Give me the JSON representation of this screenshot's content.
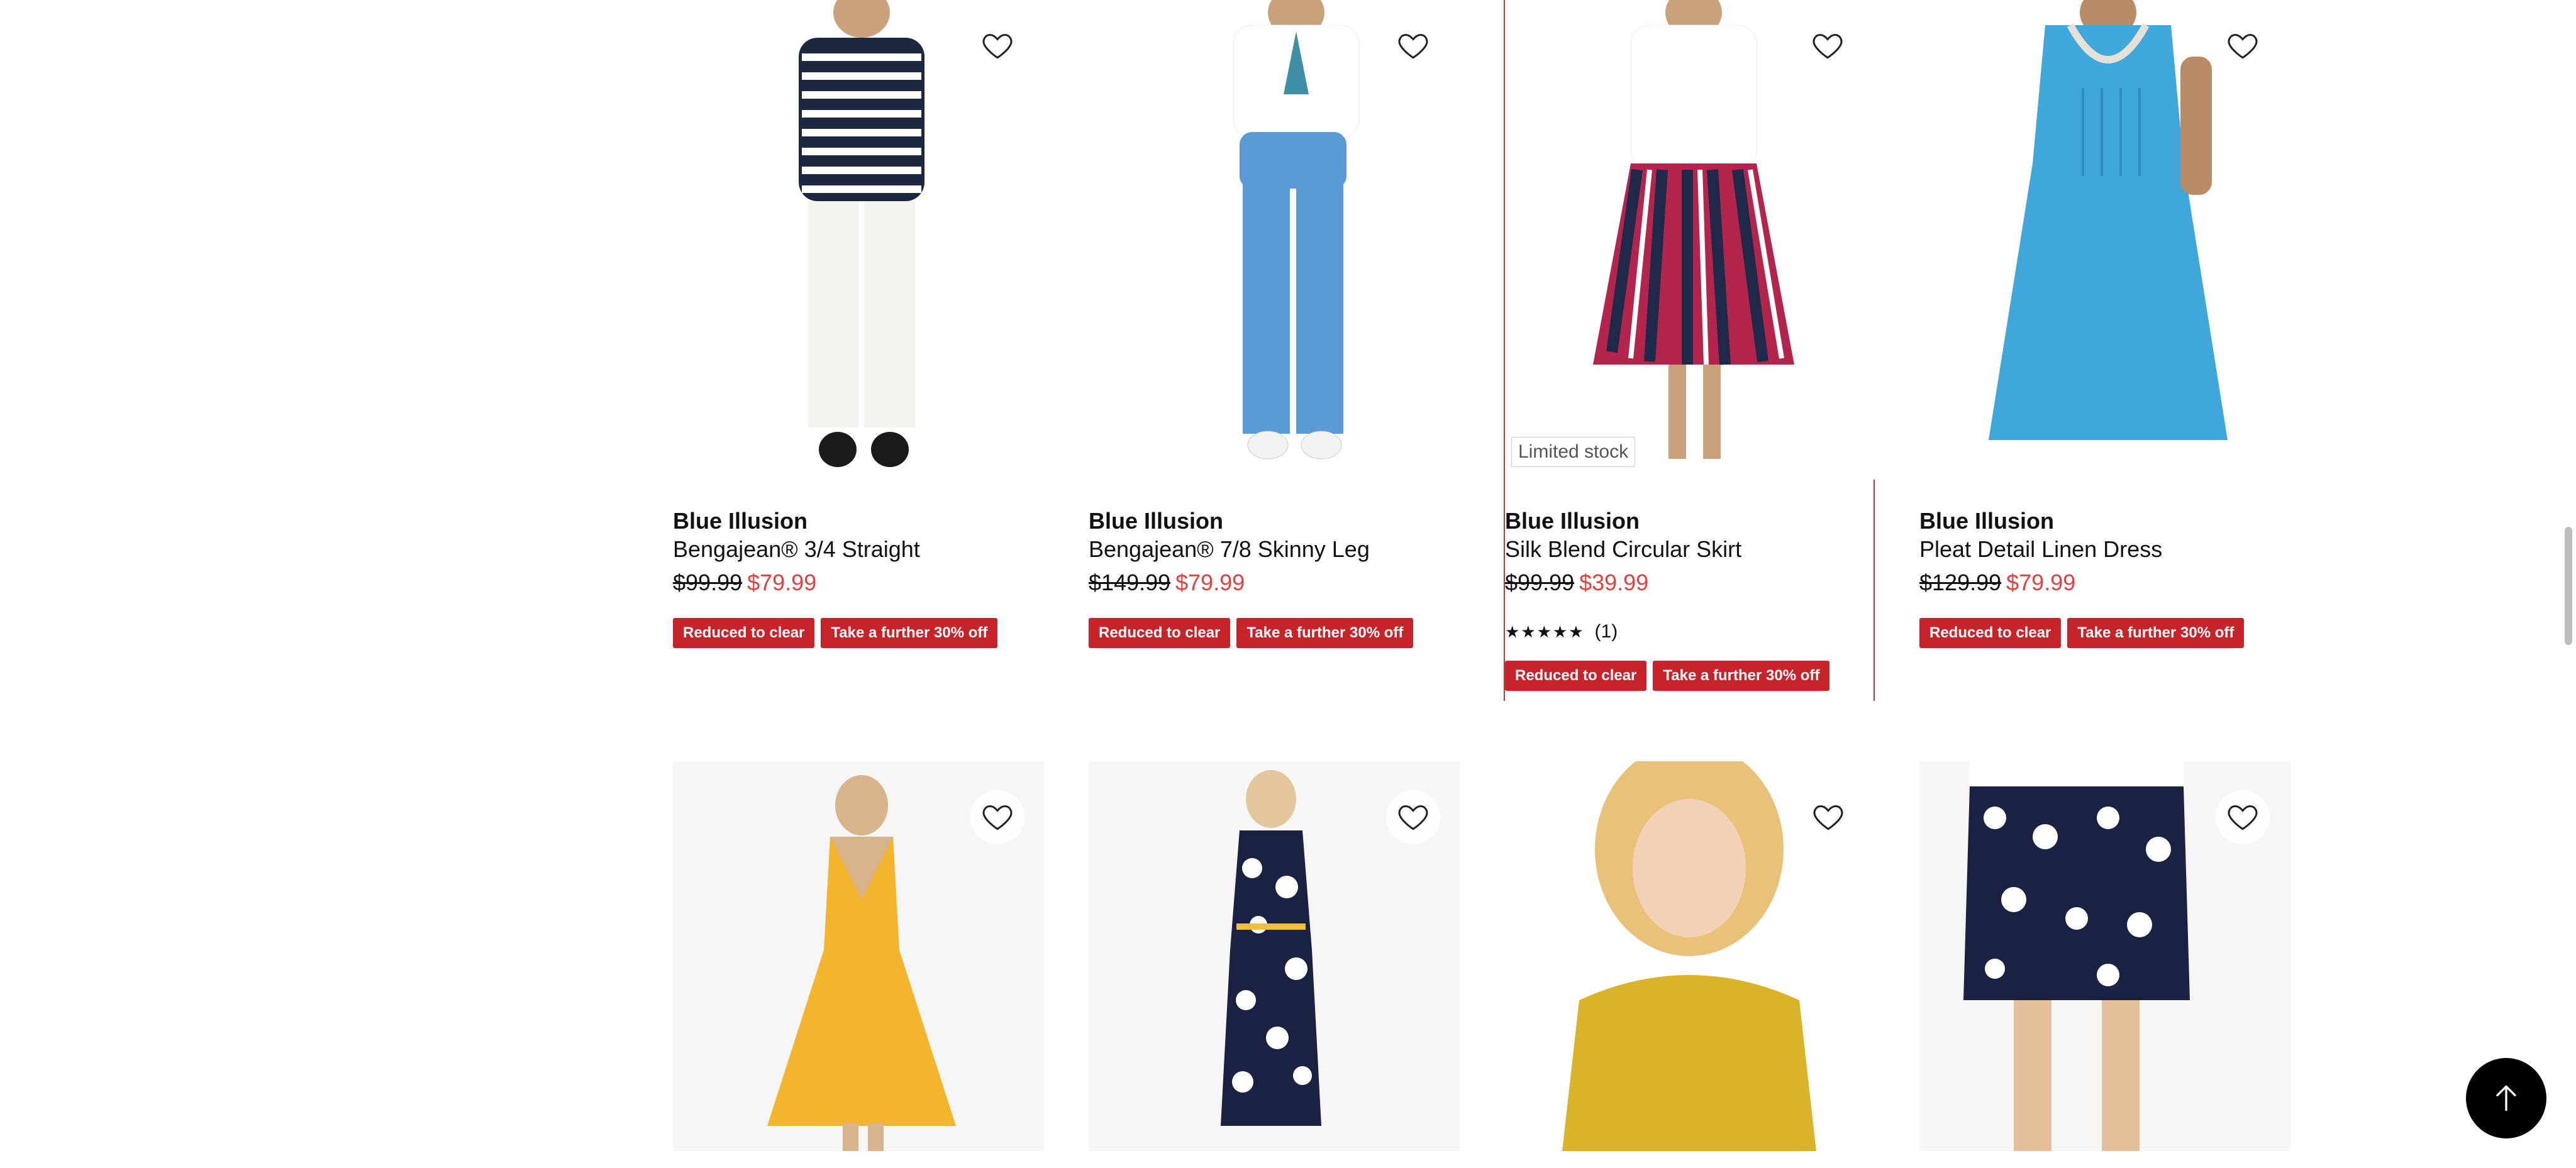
{
  "products_row1": [
    {
      "brand": "Blue Illusion",
      "name": "Bengajean® 3/4 Straight",
      "orig_price": "$99.99",
      "sale_price": "$79.99",
      "badges": [
        "Reduced to clear",
        "Take a further 30% off"
      ]
    },
    {
      "brand": "Blue Illusion",
      "name": "Bengajean® 7/8 Skinny Leg",
      "orig_price": "$149.99",
      "sale_price": "$79.99",
      "badges": [
        "Reduced to clear",
        "Take a further 30% off"
      ]
    },
    {
      "brand": "Blue Illusion",
      "name": "Silk Blend Circular Skirt",
      "orig_price": "$99.99",
      "sale_price": "$39.99",
      "limited": "Limited stock",
      "rating_stars": "★★★★★",
      "rating_count": "(1)",
      "badges": [
        "Reduced to clear",
        "Take a further 30% off"
      ]
    },
    {
      "brand": "Blue Illusion",
      "name": "Pleat Detail Linen Dress",
      "orig_price": "$129.99",
      "sale_price": "$79.99",
      "badges": [
        "Reduced to clear",
        "Take a further 30% off"
      ]
    }
  ],
  "icons": {
    "wishlist": "heart-icon",
    "back_to_top": "arrow-up-icon"
  },
  "colors": {
    "sale_price": "#e1413d",
    "badge_bg": "#c7232a",
    "highlight_border": "#d32f2f"
  }
}
